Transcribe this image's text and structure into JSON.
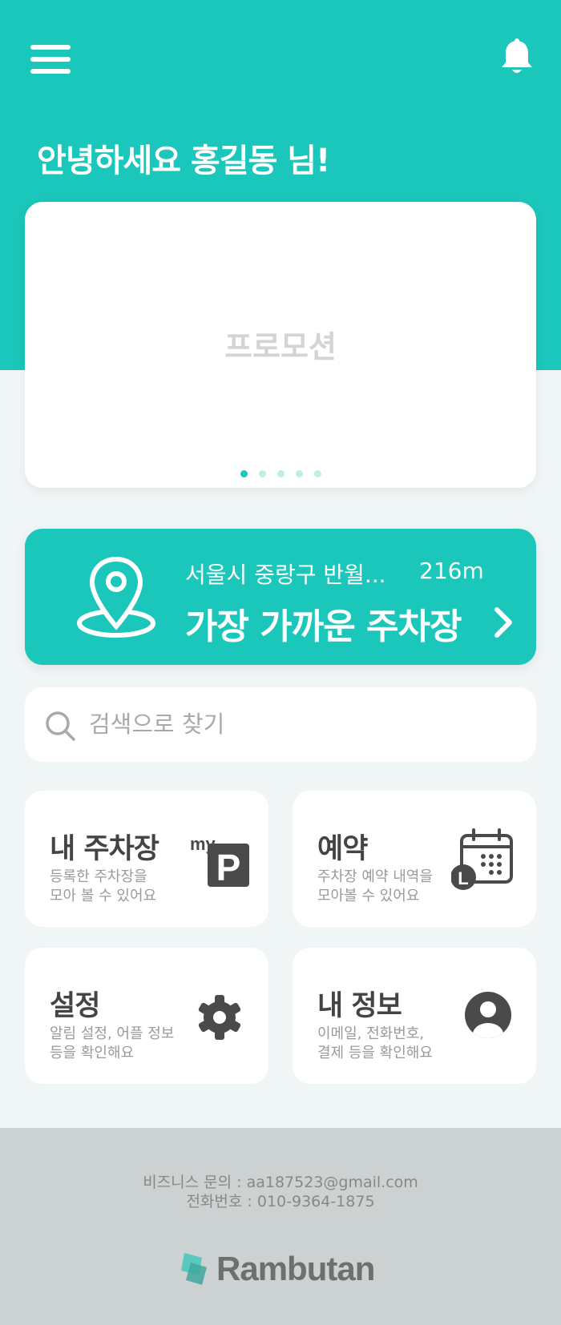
{
  "header": {
    "greeting": "안녕하세요 홍길동 님!",
    "menu_icon": "hamburger-menu-icon",
    "notification_icon": "bell-icon"
  },
  "promotion": {
    "title": "프로모션",
    "slides": 5,
    "active_slide": 1
  },
  "nearest_parking": {
    "address": "서울시 중랑구 반월...",
    "distance": "216m",
    "title": "가장 가까운 주차장",
    "icon": "location-pin-icon"
  },
  "search": {
    "placeholder": "검색으로 찾기",
    "value": "",
    "icon": "search-icon"
  },
  "tiles": [
    {
      "title": "내 주차장",
      "desc": "등록한 주차장을\n모아 볼 수 있어요",
      "icon": "my-parking-icon",
      "icon_label_small": "my",
      "icon_label_big": "P"
    },
    {
      "title": "예약",
      "desc": "주차장 예약 내역을\n모아볼 수 있어요",
      "icon": "calendar-clock-icon",
      "icon_label": "L"
    },
    {
      "title": "설정",
      "desc": "알림 설정, 어플 정보\n등을 확인해요",
      "icon": "gear-icon"
    },
    {
      "title": "내 정보",
      "desc": "이메일, 전화번호,\n결제 등을 확인해요",
      "icon": "user-profile-icon"
    }
  ],
  "footer": {
    "business_contact": "비즈니스 문의 : aa187523@gmail.com",
    "phone": "전화번호 :  010-9364-1875",
    "brand": "Rambutan",
    "logo_icon": "rambutan-logo-icon"
  },
  "colors": {
    "primary": "#1bc6ba",
    "background": "#f0f5f5",
    "card": "#ffffff",
    "footer": "#ccd1d1",
    "icon_dark": "#4a4a4a"
  }
}
